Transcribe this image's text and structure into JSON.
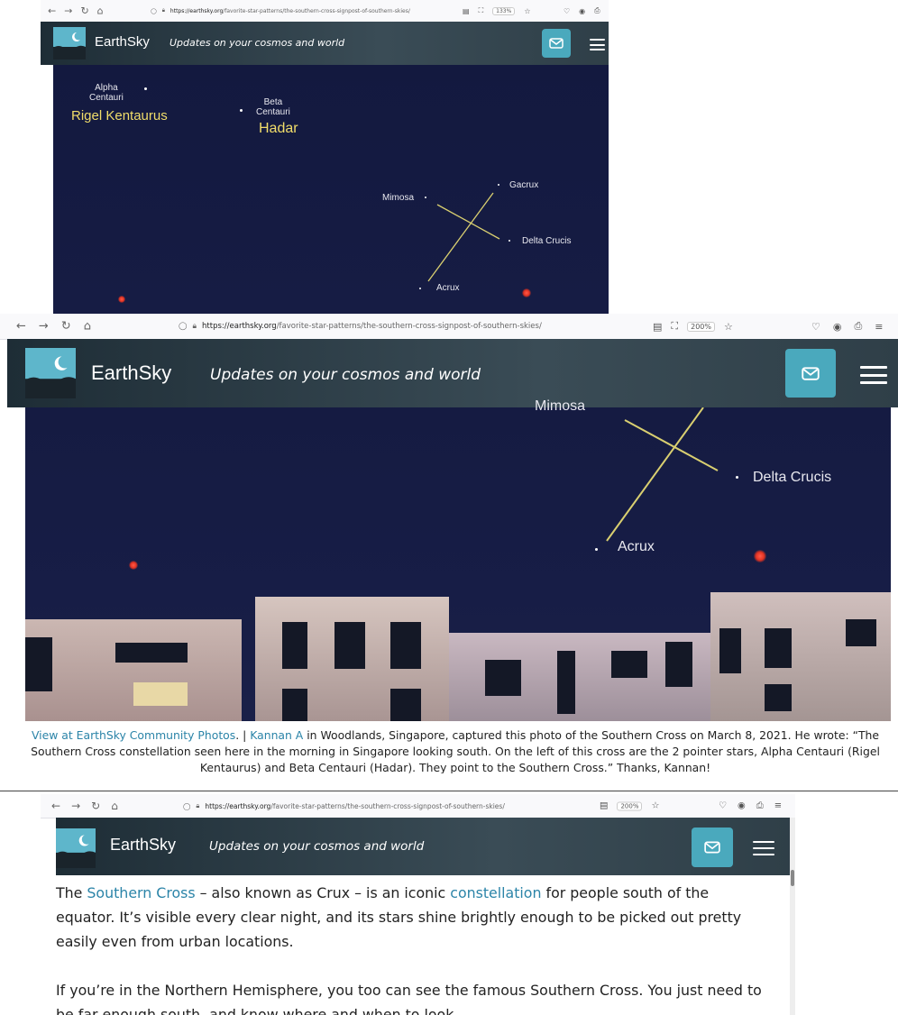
{
  "browser": {
    "url_host": "https://earthsky.org",
    "url_path": "/favorite-star-patterns/the-southern-cross-signpost-of-southern-skies/",
    "zoom_small": "133%",
    "zoom": "200%"
  },
  "site": {
    "brand": "EarthSky",
    "tagline": "Updates on your cosmos and world"
  },
  "stars": {
    "alpha": "Alpha\nCentauri",
    "rigil": "Rigel Kentaurus",
    "beta": "Beta\nCentauri",
    "hadar": "Hadar",
    "mimosa": "Mimosa",
    "gacrux": "Gacrux",
    "delta": "Delta Crucis",
    "acrux": "Acrux"
  },
  "caption": {
    "link1": "View at EarthSky Community Photos",
    "sep": ". | ",
    "link2": "Kannan A",
    "text": " in Woodlands, Singapore, captured this photo of the Southern Cross on March 8, 2021. He wrote: “The Southern Cross constellation seen here in the morning in Singapore looking south. On the left of this cross are the 2 pointer stars, Alpha Centauri (Rigel Kentaurus) and Beta Centauri (Hadar). They point to the Southern Cross.” Thanks, Kannan!"
  },
  "article": {
    "p1_pre": "The ",
    "p1_link1": "Southern Cross",
    "p1_mid": " – also known as Crux – is an iconic ",
    "p1_link2": "constellation",
    "p1_post": " for people south of the equator. It’s visible every clear night, and its stars shine brightly enough to be picked out pretty easily even from urban locations.",
    "p2": "If you’re in the Northern Hemisphere, you too can see the famous Southern Cross. You just need to be far enough south, and know where and when to look."
  },
  "colors": {
    "accent": "#4aa9bd",
    "link": "#2b84a8",
    "header": "#2c3c46",
    "sky": "#141a40",
    "gold_label": "#f1dd6a"
  }
}
